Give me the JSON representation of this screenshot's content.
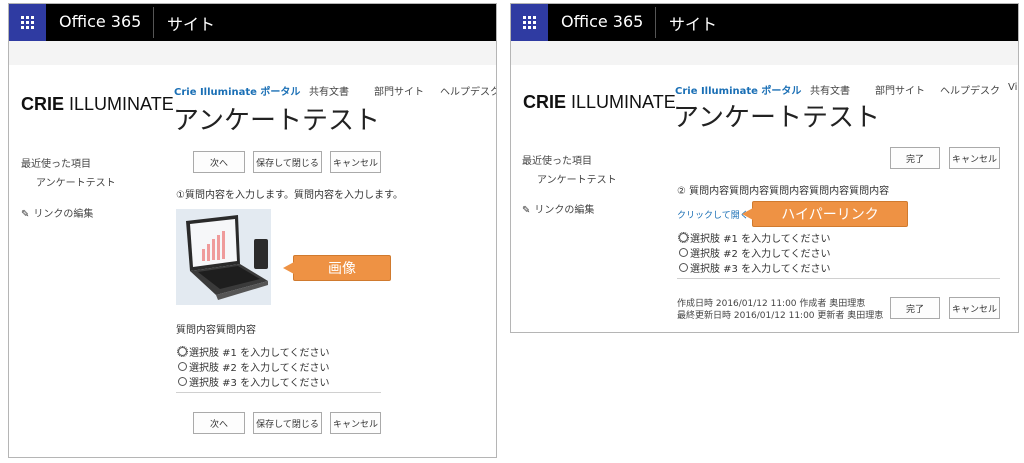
{
  "suite": {
    "app_name": "Office 365",
    "site_label": "サイト"
  },
  "logo": {
    "bold": "CRIE",
    "rest": " ILLUMINATE"
  },
  "panel_a": {
    "nav": [
      "Crie Illuminate ポータル",
      "共有文書",
      "部門サイト",
      "ヘルプデスク"
    ],
    "title": "アンケートテスト",
    "left_nav": {
      "recent": "最近使った項目",
      "recent_item": "アンケートテスト",
      "edit_links": "リンクの編集"
    },
    "buttons_top": {
      "next": "次へ",
      "save_close": "保存して閉じる",
      "cancel": "キャンセル"
    },
    "question1": "①質問内容を入力します。質問内容を入力します。",
    "image_callout": "画像",
    "question_sub": "質問内容質問内容",
    "options": [
      "選択肢 #1 を入力してください",
      "選択肢 #2 を入力してください",
      "選択肢 #3 を入力してください"
    ],
    "buttons_bottom": {
      "next": "次へ",
      "save_close": "保存して閉じる",
      "cancel": "キャンセル"
    }
  },
  "panel_b": {
    "nav": [
      "Crie Illuminate ポータル",
      "共有文書",
      "部門サイト",
      "ヘルプデスク",
      "Vi"
    ],
    "title": "アンケートテスト",
    "left_nav": {
      "recent": "最近使った項目",
      "recent_item": "アンケートテスト",
      "edit_links": "リンクの編集"
    },
    "buttons_top": {
      "done": "完了",
      "cancel": "キャンセル"
    },
    "question2": "② 質問内容質問内容質問内容質問内容質問内容",
    "link_text": "クリックして開く",
    "link_callout": "ハイパーリンク",
    "options": [
      "選択肢 #1 を入力してください",
      "選択肢 #2 を入力してください",
      "選択肢 #3 を入力してください"
    ],
    "created": "作成日時 2016/01/12 11:00 作成者 奥田理恵",
    "modified": "最終更新日時 2016/01/12 11:00 更新者 奥田理恵",
    "buttons_bottom": {
      "done": "完了",
      "cancel": "キャンセル"
    }
  },
  "colors": {
    "waffle": "#2f3ba2",
    "suite_bar": "#000000",
    "callout": "#ee9244",
    "link": "#1a6fb5"
  }
}
